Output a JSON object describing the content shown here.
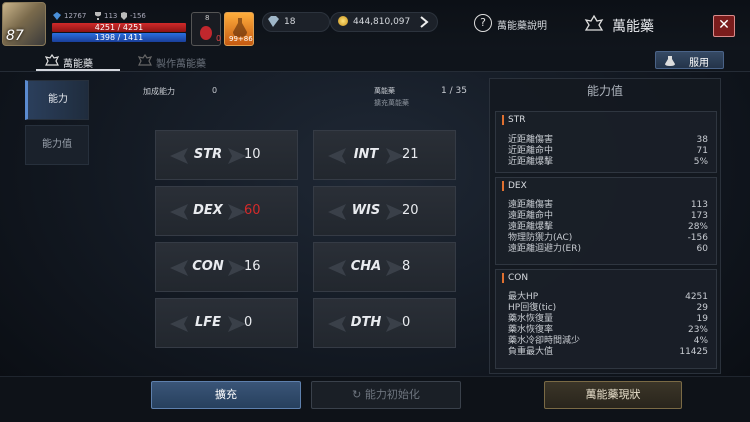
{
  "player": {
    "level": "87",
    "stat_a": "12767",
    "stat_b": "113",
    "stat_c": "-156",
    "hp_text": "4251 / 4251",
    "mp_text": "1398 / 1411",
    "potion_count": "0",
    "potion_top": "8",
    "elixir_count": "99+86"
  },
  "currency": {
    "diamonds": "18",
    "gold": "444,810,097"
  },
  "header": {
    "help_label": "萬能藥說明",
    "title": "萬能藥"
  },
  "tabs": [
    {
      "label": "萬能藥",
      "active": true
    },
    {
      "label": "製作萬能藥",
      "active": false
    }
  ],
  "use_button": "服用",
  "side_tabs": [
    "能力",
    "能力值"
  ],
  "info": {
    "bonus_label": "加成能力",
    "bonus_value": "0",
    "elixir_label": "萬能藥",
    "elixir_value": "1 / 35",
    "expand_note": "擴充萬能藥"
  },
  "stats": [
    {
      "name": "STR",
      "value": "10",
      "color": "#e9ebef"
    },
    {
      "name": "INT",
      "value": "21",
      "color": "#e9ebef"
    },
    {
      "name": "DEX",
      "value": "60",
      "color": "#d42a2a"
    },
    {
      "name": "WIS",
      "value": "20",
      "color": "#e9ebef"
    },
    {
      "name": "CON",
      "value": "16",
      "color": "#e9ebef"
    },
    {
      "name": "CHA",
      "value": "8",
      "color": "#e9ebef"
    },
    {
      "name": "LFE",
      "value": "0",
      "color": "#e9ebef"
    },
    {
      "name": "DTH",
      "value": "0",
      "color": "#e9ebef"
    }
  ],
  "panel": {
    "title": "能力值",
    "groups": [
      {
        "name": "STR",
        "rows": [
          {
            "label": "近距離傷害",
            "value": "38"
          },
          {
            "label": "近距離命中",
            "value": "71"
          },
          {
            "label": "近距離爆擊",
            "value": "5%"
          }
        ]
      },
      {
        "name": "DEX",
        "rows": [
          {
            "label": "遠距離傷害",
            "value": "113"
          },
          {
            "label": "遠距離命中",
            "value": "173"
          },
          {
            "label": "遠距離爆擊",
            "value": "28%"
          },
          {
            "label": "物理防禦力(AC)",
            "value": "-156"
          },
          {
            "label": "遠距離迴避力(ER)",
            "value": "60"
          }
        ]
      },
      {
        "name": "CON",
        "rows": [
          {
            "label": "最大HP",
            "value": "4251"
          },
          {
            "label": "HP回復(tic)",
            "value": "29"
          },
          {
            "label": "藥水恢復量",
            "value": "19"
          },
          {
            "label": "藥水恢復率",
            "value": "23%"
          },
          {
            "label": "藥水冷卻時間減少",
            "value": "4%"
          },
          {
            "label": "負重最大值",
            "value": "11425"
          }
        ]
      }
    ]
  },
  "buttons": {
    "expand": "擴充",
    "reset": "能力初始化",
    "status": "萬能藥現狀"
  },
  "colors": {
    "accent": "#5b8bd0",
    "hp": "#d02a2a",
    "mp": "#2b6fe0",
    "close": "#7a1c1c",
    "highlight_value": "#d42a2a",
    "group_marker": "#e07030"
  }
}
